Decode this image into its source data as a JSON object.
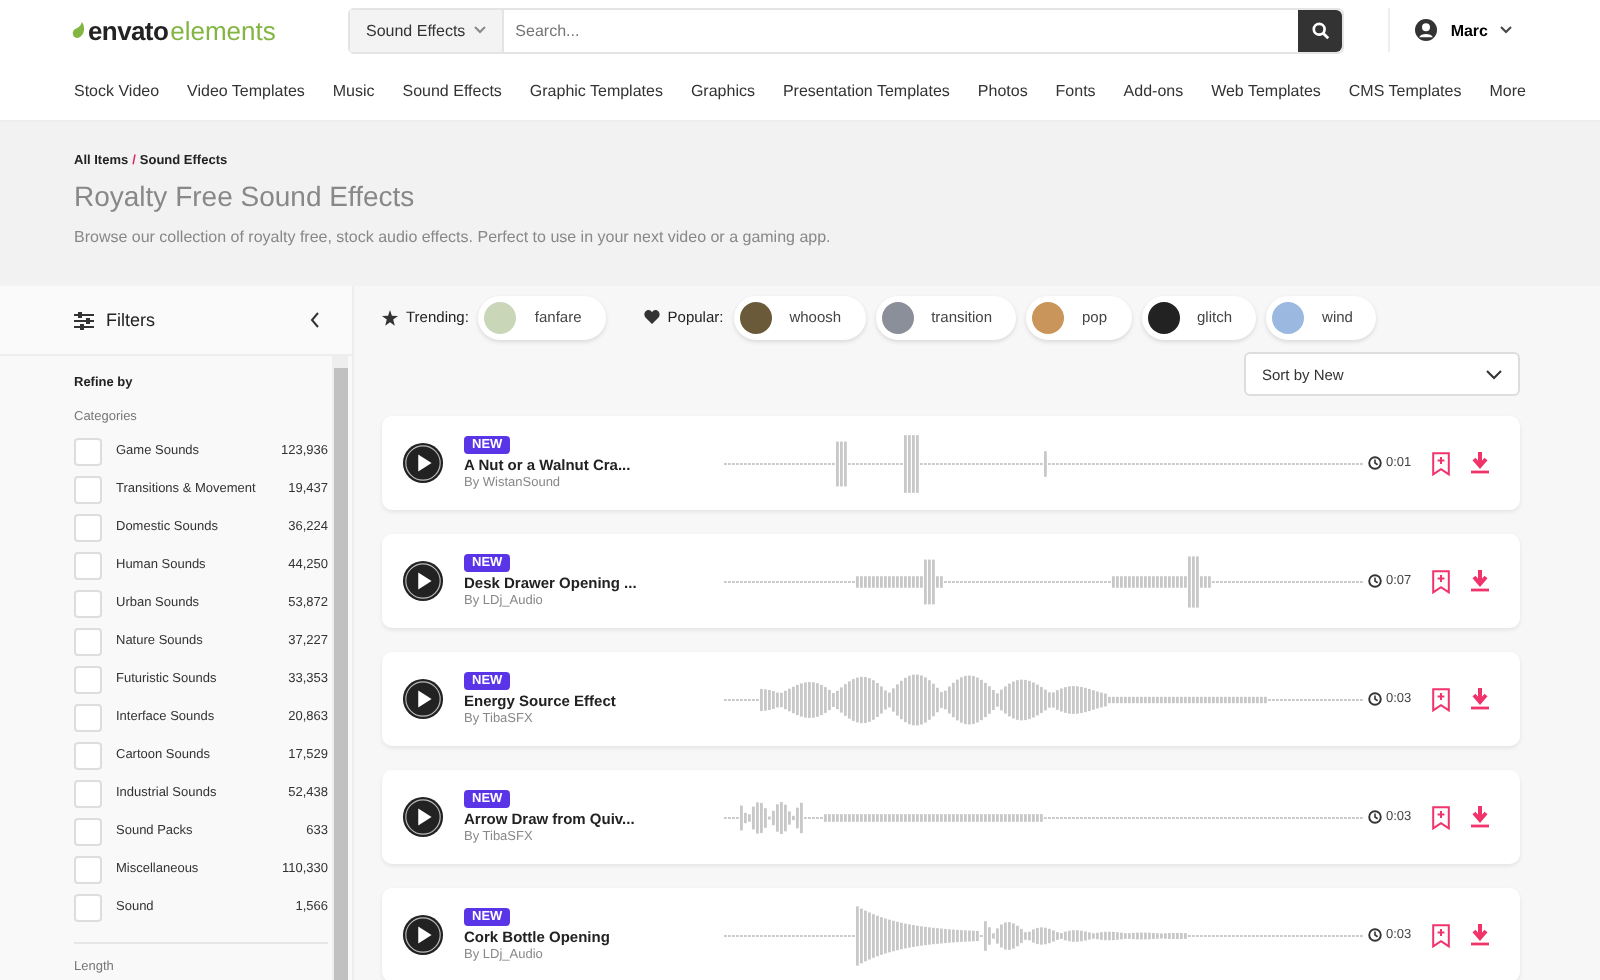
{
  "header": {
    "logo": {
      "brand": "envato",
      "product": "elements"
    },
    "search_category": "Sound Effects",
    "search": {
      "placeholder": "Search..."
    },
    "user": "Marc"
  },
  "nav": [
    "Stock Video",
    "Video Templates",
    "Music",
    "Sound Effects",
    "Graphic Templates",
    "Graphics",
    "Presentation Templates",
    "Photos",
    "Fonts",
    "Add-ons",
    "Web Templates",
    "CMS Templates",
    "More"
  ],
  "hero": {
    "breadcrumb": [
      "All Items",
      "/",
      "Sound Effects"
    ],
    "title": "Royalty Free Sound Effects",
    "description": "Browse our collection of royalty free, stock audio effects. Perfect to use in your next video or a gaming app."
  },
  "sidebar": {
    "title": "Filters",
    "refine": "Refine by",
    "section": "Categories",
    "categories": [
      {
        "name": "Game Sounds",
        "count": "123,936",
        "checked": false
      },
      {
        "name": "Transitions & Movement",
        "count": "19,437",
        "checked": false
      },
      {
        "name": "Domestic Sounds",
        "count": "36,224",
        "checked": false
      },
      {
        "name": "Human Sounds",
        "count": "44,250",
        "checked": false
      },
      {
        "name": "Urban Sounds",
        "count": "53,872",
        "checked": false
      },
      {
        "name": "Nature Sounds",
        "count": "37,227",
        "checked": false
      },
      {
        "name": "Futuristic Sounds",
        "count": "33,353",
        "checked": false
      },
      {
        "name": "Interface Sounds",
        "count": "20,863",
        "checked": false
      },
      {
        "name": "Cartoon Sounds",
        "count": "17,529",
        "checked": false
      },
      {
        "name": "Industrial Sounds",
        "count": "52,438",
        "checked": false
      },
      {
        "name": "Sound Packs",
        "count": "633",
        "checked": false
      },
      {
        "name": "Miscellaneous",
        "count": "110,330",
        "checked": false
      },
      {
        "name": "Sound",
        "count": "1,566",
        "checked": false
      }
    ],
    "next_section": "Length"
  },
  "trending": {
    "label": "Trending:",
    "tags": [
      {
        "label": "fanfare",
        "color": "#c9d6b8"
      }
    ]
  },
  "popular": {
    "label": "Popular:",
    "tags": [
      {
        "label": "whoosh",
        "color": "#6b5a3a"
      },
      {
        "label": "transition",
        "color": "#8a8f99"
      },
      {
        "label": "pop",
        "color": "#c9955a"
      },
      {
        "label": "glitch",
        "color": "#222222"
      },
      {
        "label": "wind",
        "color": "#9bb8e0"
      }
    ]
  },
  "sort": "Sort by New",
  "tracks": [
    {
      "badge": "NEW",
      "title": "A Nut or a Walnut Cra...",
      "author": "By WistanSound",
      "duration": "0:01"
    },
    {
      "badge": "NEW",
      "title": "Desk Drawer Opening ...",
      "author": "By LDj_Audio",
      "duration": "0:07"
    },
    {
      "badge": "NEW",
      "title": "Energy Source Effect",
      "author": "By TibaSFX",
      "duration": "0:03"
    },
    {
      "badge": "NEW",
      "title": "Arrow Draw from Quiv...",
      "author": "By TibaSFX",
      "duration": "0:03"
    },
    {
      "badge": "NEW",
      "title": "Cork Bottle Opening",
      "author": "By LDj_Audio",
      "duration": "0:03"
    }
  ]
}
